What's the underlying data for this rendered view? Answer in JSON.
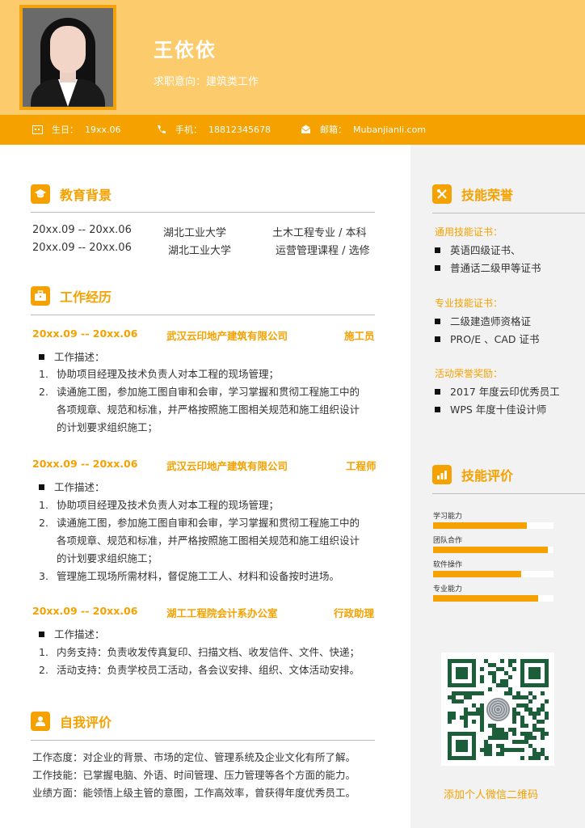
{
  "header": {
    "name": "王依依",
    "intent": "求职意向：建筑类工作"
  },
  "contact": {
    "birth_label": "生日：",
    "birth_value": "19xx.06",
    "phone_label": "手机：",
    "phone_value": "18812345678",
    "email_label": "邮箱：",
    "email_value": "Mubanjianli.com"
  },
  "education": {
    "title": "教育背景",
    "rows": [
      {
        "date": "20xx.09 -- 20xx.06",
        "school": "湖北工业大学",
        "major": "土木工程专业 / 本科"
      },
      {
        "date": "20xx.09 -- 20xx.06",
        "school": "湖北工业大学",
        "major": "运营管理课程 / 选修"
      }
    ]
  },
  "work": {
    "title": "工作经历",
    "desc_label": "工作描述：",
    "jobs": [
      {
        "date": "20xx.09 -- 20xx.06",
        "company": "武汉云印地产建筑有限公司",
        "role": "施工员",
        "items": [
          "协助项目经理及技术负责人对本工程的现场管理；",
          "读通施工图，参加施工图自审和会审，学习掌握和贯彻工程施工中的",
          "各项规章、规范和标准，并严格按照施工图相关规范和施工组织设计",
          "的计划要求组织施工；"
        ]
      },
      {
        "date": "20xx.09 -- 20xx.06",
        "company": "武汉云印地产建筑有限公司",
        "role": "工程师",
        "items": [
          "协助项目经理及技术负责人对本工程的现场管理；",
          "读通施工图，参加施工图自审和会审，学习掌握和贯彻工程施工中的",
          "各项规章、规范和标准，并严格按照施工图相关规范和施工组织设计",
          "的计划要求组织施工；",
          "管理施工现场所需材料，督促施工工人、材料和设备按时进场。"
        ]
      },
      {
        "date": "20xx.09 -- 20xx.06",
        "company": "湖工工程院会计系办公室",
        "role": "行政助理",
        "items": [
          "内务支持：负责收发传真复印、扫描文档、收发信件、文件、快递；",
          "活动支持：负责学校员工活动，各会议安排、组织、文体活动安排。"
        ]
      }
    ]
  },
  "self": {
    "title": "自我评价",
    "lines": [
      "工作态度：对企业的背景、市场的定位、管理系统及企业文化有所了解。",
      "工作技能：已掌握电脑、外语、时间管理、压力管理等各个方面的能力。",
      "业绩方面：能领悟上级主管的意图，工作高效率，曾获得年度优秀员工。"
    ]
  },
  "honors": {
    "title": "技能荣誉",
    "groups": [
      {
        "label": "通用技能证书：",
        "items": [
          "英语四级证书、",
          "普通话二级甲等证书"
        ]
      },
      {
        "label": "专业技能证书：",
        "items": [
          "二级建造师资格证",
          "PRO/E 、CAD 证书"
        ]
      },
      {
        "label": "活动荣誉奖励：",
        "items": [
          "2017 年度云印优秀员工",
          "WPS 年度十佳设计师"
        ]
      }
    ]
  },
  "skills": {
    "title": "技能评价",
    "bars": [
      {
        "label": "学习能力",
        "level": 0.78
      },
      {
        "label": "团队合作",
        "level": 0.95
      },
      {
        "label": "软件操作",
        "level": 0.73
      },
      {
        "label": "专业能力",
        "level": 0.87
      }
    ]
  },
  "qr": {
    "caption": "添加个人微信二维码"
  },
  "colors": {
    "accent": "#f5a100",
    "header_bg": "#fccb6b"
  }
}
